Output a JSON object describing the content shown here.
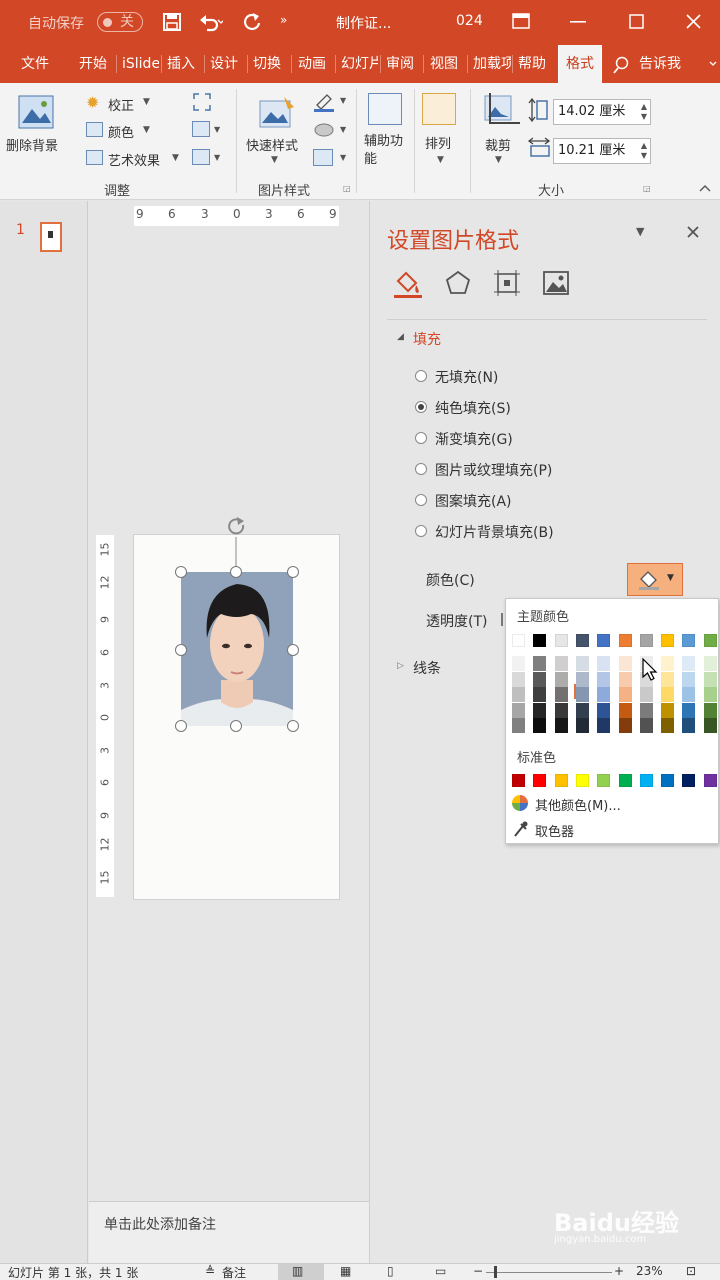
{
  "titlebar": {
    "autosave_label": "自动保存",
    "autosave_state": "关",
    "doc_title": "制作证...",
    "doc_num": "024"
  },
  "tabs": [
    {
      "label": "文件"
    },
    {
      "label": "开始"
    },
    {
      "label": "iSlide"
    },
    {
      "label": "插入"
    },
    {
      "label": "设计"
    },
    {
      "label": "切换"
    },
    {
      "label": "动画"
    },
    {
      "label": "幻灯片"
    },
    {
      "label": "审阅"
    },
    {
      "label": "视图"
    },
    {
      "label": "加载项"
    },
    {
      "label": "帮助"
    },
    {
      "label": "格式"
    }
  ],
  "tell_me": "告诉我",
  "ribbon": {
    "remove_bg": "删除背景",
    "correct": "校正",
    "color": "颜色",
    "art_effects": "艺术效果",
    "group_adjust": "调整",
    "quick_styles": "快速样式",
    "group_picture_styles": "图片样式",
    "accessibility": "辅助功能",
    "arrange": "排列",
    "crop": "裁剪",
    "height_value": "14.02 厘米",
    "width_value": "10.21 厘米",
    "group_size": "大小"
  },
  "slide_number": "1",
  "ruler_top": [
    "9",
    "6",
    "3",
    "0",
    "3",
    "6",
    "9"
  ],
  "ruler_left": [
    "15",
    "12",
    "9",
    "6",
    "3",
    "0",
    "3",
    "6",
    "9",
    "12",
    "15"
  ],
  "notes_placeholder": "单击此处添加备注",
  "pane": {
    "title": "设置图片格式",
    "section_fill": "填充",
    "options": [
      {
        "label": "无填充(N)",
        "selected": false
      },
      {
        "label": "纯色填充(S)",
        "selected": true
      },
      {
        "label": "渐变填充(G)",
        "selected": false
      },
      {
        "label": "图片或纹理填充(P)",
        "selected": false
      },
      {
        "label": "图案填充(A)",
        "selected": false
      },
      {
        "label": "幻灯片背景填充(B)",
        "selected": false
      }
    ],
    "color_label": "颜色(C)",
    "transparency_label": "透明度(T)",
    "section_line": "线条"
  },
  "popup": {
    "theme_title": "主题颜色",
    "standard_title": "标准色",
    "more_colors": "其他颜色(M)...",
    "eyedropper": "取色器",
    "theme_top": [
      "#ffffff",
      "#000000",
      "#e7e6e6",
      "#44546a",
      "#4472c4",
      "#ed7d31",
      "#a5a5a5",
      "#ffc000",
      "#5b9bd5",
      "#70ad47"
    ],
    "theme_shades": [
      [
        "#f2f2f2",
        "#d9d9d9",
        "#bfbfbf",
        "#a6a6a6",
        "#808080"
      ],
      [
        "#7f7f7f",
        "#595959",
        "#3f3f3f",
        "#262626",
        "#0d0d0d"
      ],
      [
        "#d0cece",
        "#aeabab",
        "#757070",
        "#3a3838",
        "#171616"
      ],
      [
        "#d6dce4",
        "#adb9ca",
        "#8496b0",
        "#333f4f",
        "#222a35"
      ],
      [
        "#d9e2f3",
        "#b4c6e7",
        "#8eaadb",
        "#2f5496",
        "#1f3864"
      ],
      [
        "#fbe5d5",
        "#f7cbac",
        "#f4b183",
        "#c55a11",
        "#833c0b"
      ],
      [
        "#ededed",
        "#dbdbdb",
        "#c9c9c9",
        "#7b7b7b",
        "#525252"
      ],
      [
        "#fff2cc",
        "#fee599",
        "#ffd965",
        "#bf9000",
        "#7f6000"
      ],
      [
        "#deebf6",
        "#bdd7ee",
        "#9cc3e5",
        "#2e75b5",
        "#1e4e79"
      ],
      [
        "#e2efd9",
        "#c5e0b3",
        "#a8d08d",
        "#538135",
        "#375623"
      ]
    ],
    "standard": [
      "#c00000",
      "#ff0000",
      "#ffc000",
      "#ffff00",
      "#92d050",
      "#00b050",
      "#00b0f0",
      "#0070c0",
      "#002060",
      "#7030a0"
    ]
  },
  "statusbar": {
    "slide_info": "幻灯片 第 1 张，共 1 张",
    "notes": "备注",
    "zoom": "23%"
  },
  "watermark": {
    "brand": "Baidu经验",
    "url": "jingyan.baidu.com"
  }
}
